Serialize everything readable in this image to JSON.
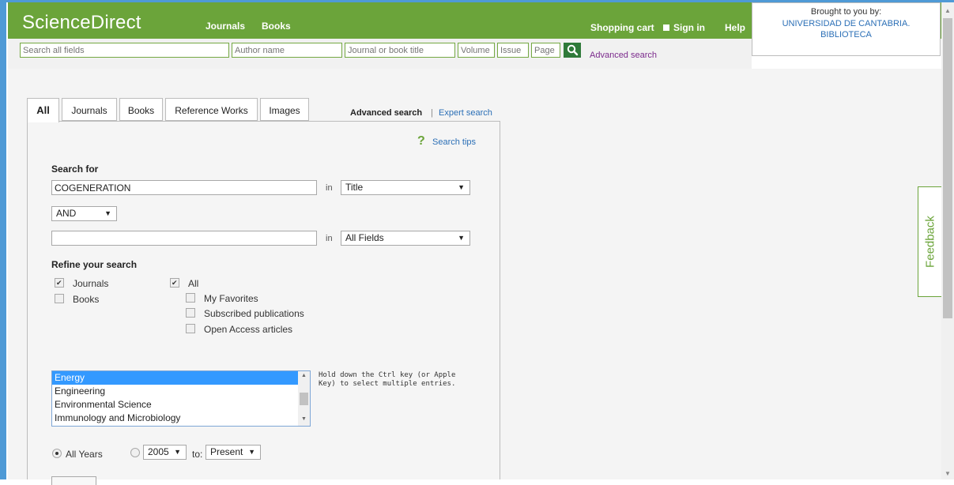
{
  "header": {
    "logo": "ScienceDirect",
    "nav": {
      "journals": "Journals",
      "books": "Books"
    },
    "shopping_cart": "Shopping cart",
    "sign_in": "Sign in",
    "help": "Help"
  },
  "institution": {
    "brought_label": "Brought to you by:",
    "name": "UNIVERSIDAD DE CANTABRIA. BIBLIOTECA"
  },
  "quick_search": {
    "all_fields_placeholder": "Search all fields",
    "author_placeholder": "Author name",
    "journal_placeholder": "Journal or book title",
    "volume_placeholder": "Volume",
    "issue_placeholder": "Issue",
    "page_placeholder": "Page",
    "advanced_link": "Advanced search"
  },
  "tabs": [
    {
      "label": "All"
    },
    {
      "label": "Journals"
    },
    {
      "label": "Books"
    },
    {
      "label": "Reference Works"
    },
    {
      "label": "Images"
    }
  ],
  "mode": {
    "advanced": "Advanced search",
    "separator": "|",
    "expert": "Expert search"
  },
  "search_tips": "Search tips",
  "form": {
    "search_for_label": "Search for",
    "term1": {
      "value": "COGENERATION",
      "in_label": "in",
      "field": "Title"
    },
    "operator": "AND",
    "term2": {
      "value": "",
      "in_label": "in",
      "field": "All Fields"
    },
    "refine_label": "Refine your search",
    "sources": {
      "journals": {
        "label": "Journals",
        "checked": true
      },
      "books": {
        "label": "Books",
        "checked": false
      }
    },
    "scope": {
      "all": {
        "label": "All",
        "checked": true
      },
      "my_favorites": {
        "label": "My Favorites",
        "checked": false
      },
      "subscribed": {
        "label": "Subscribed publications",
        "checked": false
      },
      "open_access": {
        "label": "Open Access articles",
        "checked": false
      }
    },
    "subjects": [
      {
        "label": "Energy",
        "selected": true
      },
      {
        "label": "Engineering",
        "selected": false
      },
      {
        "label": "Environmental Science",
        "selected": false
      },
      {
        "label": "Immunology and Microbiology",
        "selected": false
      }
    ],
    "hint": "Hold down the Ctrl key (or Apple Key) to select multiple entries.",
    "years": {
      "all_years_label": "All Years",
      "all_years_selected": true,
      "from": "2005",
      "to_label": "to:",
      "to": "Present"
    }
  },
  "feedback": "Feedback",
  "colors": {
    "brand_green": "#6ba43a",
    "link_blue": "#2b6fb6",
    "visited_purple": "#7b2a8c"
  }
}
